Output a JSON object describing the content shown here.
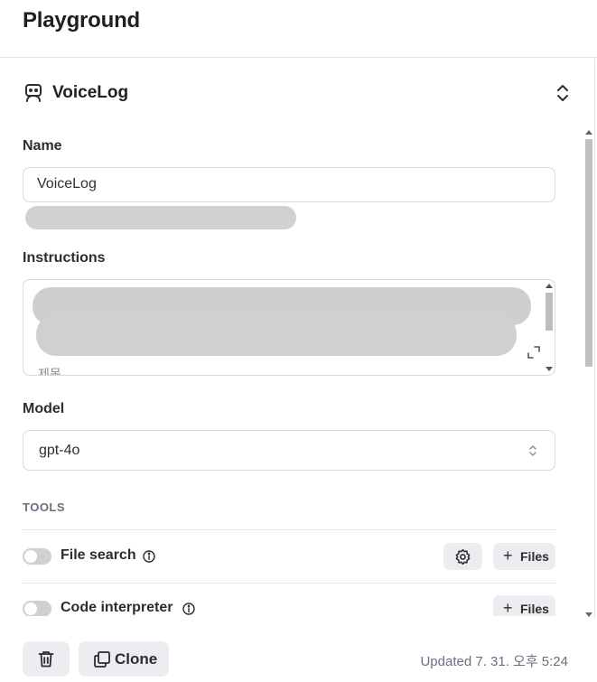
{
  "header": {
    "title": "Playground"
  },
  "assistant": {
    "name": "VoiceLog",
    "icon": "bot-icon"
  },
  "form": {
    "name_label": "Name",
    "name_value": "VoiceLog",
    "instructions_label": "Instructions",
    "instructions_peek": "제목",
    "model_label": "Model",
    "model_value": "gpt-4o"
  },
  "tools": {
    "section_title": "TOOLS",
    "items": [
      {
        "label": "File search",
        "enabled": false,
        "files_label": "Files"
      },
      {
        "label": "Code interpreter",
        "enabled": false,
        "files_label": "Files"
      }
    ]
  },
  "footer": {
    "clone_label": "Clone",
    "updated_text": "Updated 7. 31. 오후 5:24"
  }
}
